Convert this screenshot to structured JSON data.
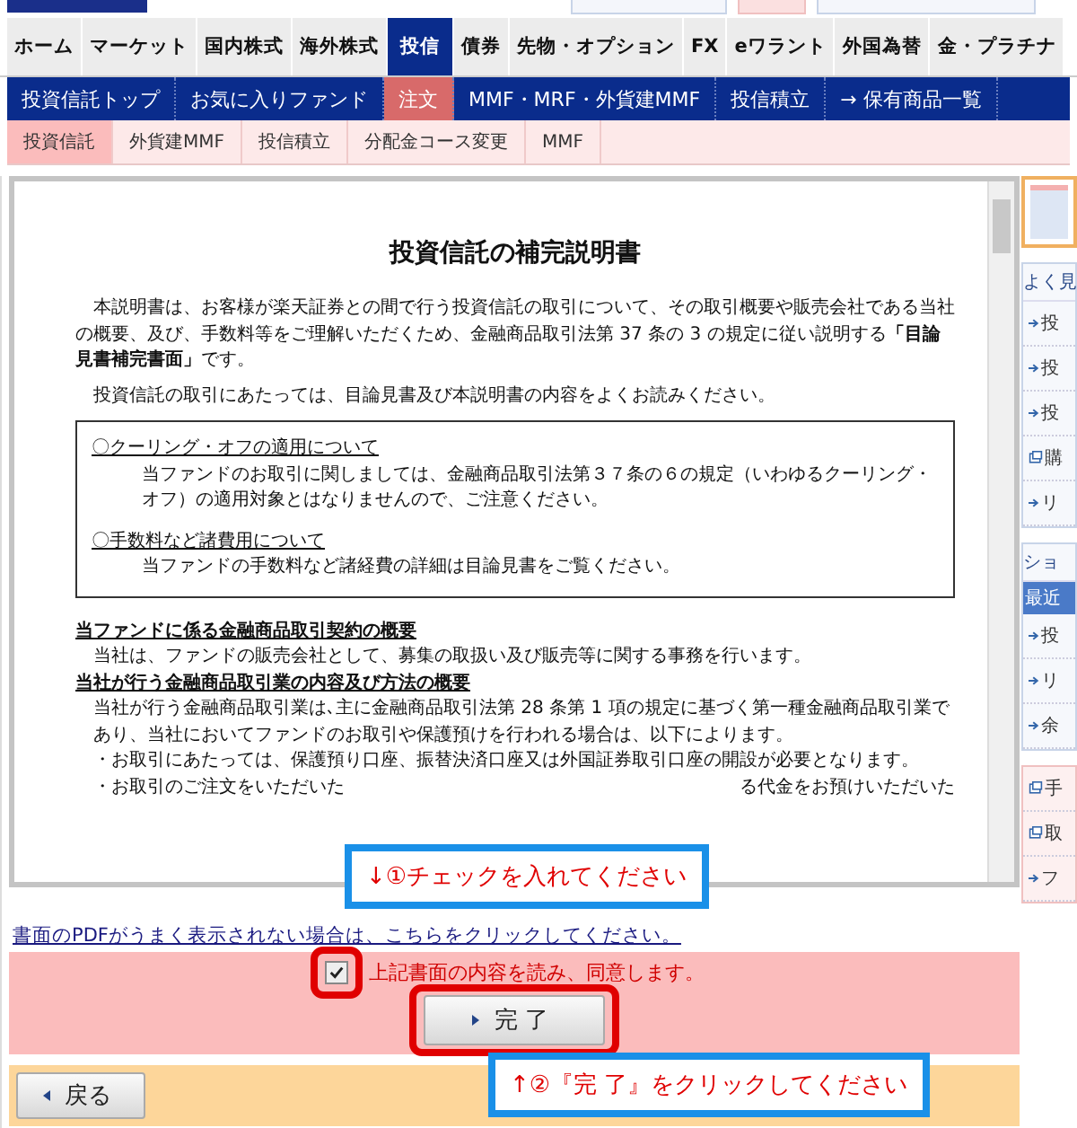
{
  "global_nav": [
    {
      "label": "ホーム",
      "selected": false
    },
    {
      "label": "マーケット",
      "selected": false
    },
    {
      "label": "国内株式",
      "selected": false
    },
    {
      "label": "海外株式",
      "selected": false
    },
    {
      "label": "投信",
      "selected": true
    },
    {
      "label": "債券",
      "selected": false
    },
    {
      "label": "先物・オプション",
      "selected": false
    },
    {
      "label": "FX",
      "selected": false
    },
    {
      "label": "eワラント",
      "selected": false
    },
    {
      "label": "外国為替",
      "selected": false
    },
    {
      "label": "金・プラチナ",
      "selected": false
    }
  ],
  "sub_nav": [
    {
      "label": "投資信託トップ",
      "selected": false
    },
    {
      "label": "お気に入りファンド",
      "selected": false
    },
    {
      "label": "注文",
      "selected": true
    },
    {
      "label": "MMF・MRF・外貨建MMF",
      "selected": false
    },
    {
      "label": "投信積立",
      "selected": false
    },
    {
      "label": "→ 保有商品一覧",
      "selected": false
    }
  ],
  "order_tabs": [
    {
      "label": "投資信託",
      "selected": true
    },
    {
      "label": "外貨建MMF",
      "selected": false
    },
    {
      "label": "投信積立",
      "selected": false
    },
    {
      "label": "分配金コース変更",
      "selected": false
    },
    {
      "label": "MMF",
      "selected": false
    }
  ],
  "document": {
    "title": "投資信託の補完説明書",
    "paragraphs": [
      "本説明書は、お客様が楽天証券との間で行う投資信託の取引について、その取引概要や販売会社である当社の概要、及び、手数料等をご理解いただくため、金融商品取引法第 37 条の 3 の規定に従い説明する**「目論見書補完書面」**です。",
      "投資信託の取引にあたっては、目論見書及び本説明書の内容をよくお読みください。"
    ],
    "notice_box": [
      {
        "heading": "〇クーリング・オフの適用について",
        "text": "当ファンドのお取引に関しましては、金融商品取引法第３７条の６の規定（いわゆるクーリング・オフ）の適用対象とはなりませんので、ご注意ください。"
      },
      {
        "heading": "〇手数料など諸費用について",
        "text": "当ファンドの手数料など諸経費の詳細は目論見書をご覧ください。"
      }
    ],
    "sections": [
      {
        "heading": "当ファンドに係る金融商品取引契約の概要",
        "text": "当社は、ファンドの販売会社として、募集の取扱い及び販売等に関する事務を行います。"
      },
      {
        "heading": "当社が行う金融商品取引業の内容及び方法の概要",
        "text": "当社が行う金融商品取引業は､主に金融商品取引法第 28 条第 1 項の規定に基づく第一種金融商品取引業であり、当社においてファンドのお取引や保護預けを行われる場合は、以下によります。"
      }
    ],
    "bullets": [
      {
        "start": "・お取引にあたっては、保護預り口座、振替決済口座又は外国証券取引口座の開設が必要となります。"
      },
      {
        "start": "・お取引のご注文をいただいた",
        "end": "る代金をお預けいただいた"
      }
    ]
  },
  "pdf_link": "書面のPDFがうまく表示されない場合は、こちらをクリックしてください。",
  "agree": {
    "label": "上記書面の内容を読み、同意します。",
    "checked": true
  },
  "complete_button": "完 了",
  "back_button": "戻る",
  "annotations": [
    {
      "kind": "down",
      "text": "↓①チェックを入れてください"
    },
    {
      "kind": "up",
      "text": "↑②『完 了』をクリックしてください"
    }
  ],
  "side_panels": [
    {
      "kind": "thumbnail"
    },
    {
      "kind": "list",
      "heading": "よく見",
      "items": [
        {
          "text": "投",
          "kind": "link"
        },
        {
          "text": "投",
          "kind": "link"
        },
        {
          "text": "投",
          "kind": "link"
        },
        {
          "text": "購",
          "kind": "popup"
        },
        {
          "text": "リ",
          "kind": "link"
        }
      ]
    },
    {
      "kind": "tabs",
      "heading": "ショ",
      "tab": "最近",
      "items": [
        {
          "text": "投",
          "kind": "link"
        },
        {
          "text": "リ",
          "kind": "link"
        },
        {
          "text": "余",
          "kind": "link"
        }
      ]
    },
    {
      "kind": "links",
      "items": [
        {
          "text": "手",
          "kind": "popup"
        },
        {
          "text": "取",
          "kind": "popup"
        },
        {
          "text": "フ",
          "kind": "link"
        }
      ]
    }
  ]
}
